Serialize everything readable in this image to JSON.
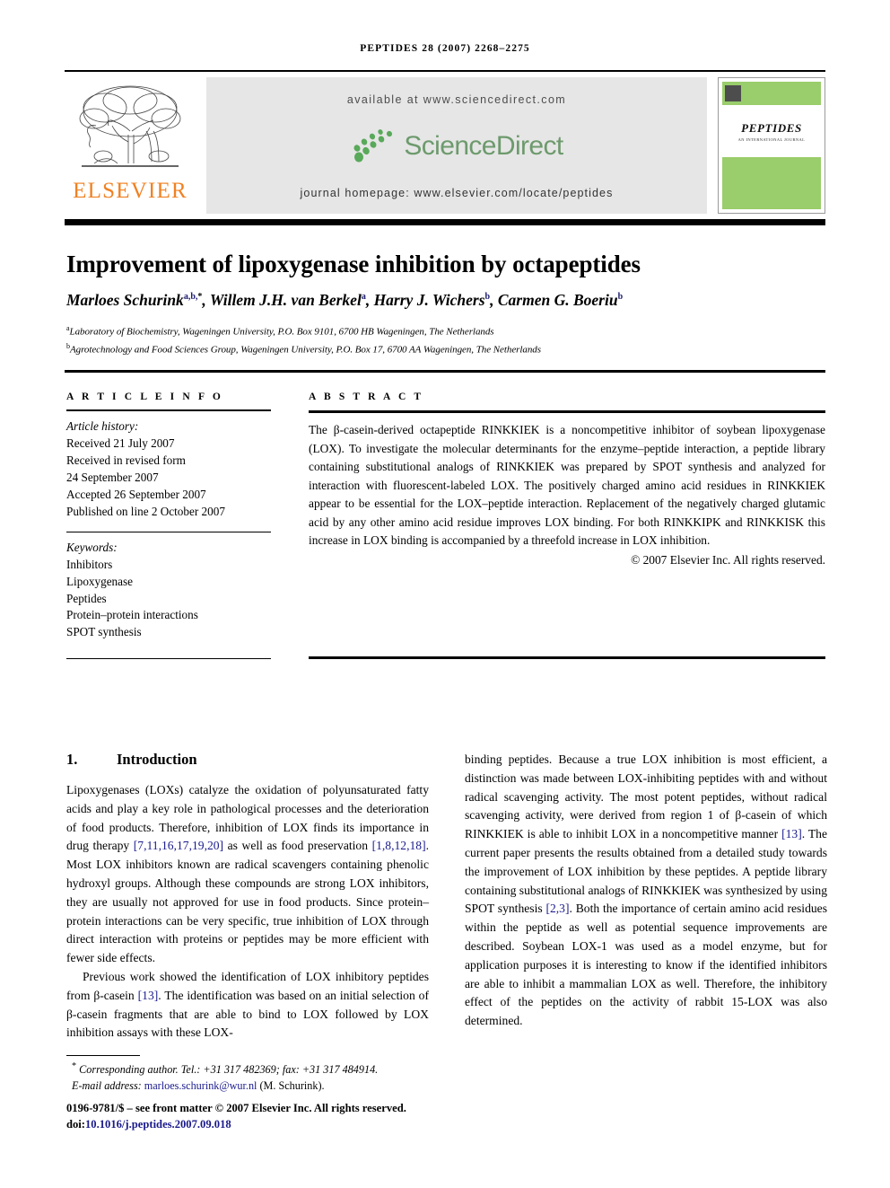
{
  "running_head": "PEPTIDES 28 (2007) 2268–2275",
  "masthead": {
    "publisher_name": "ELSEVIER",
    "available_at": "available at www.sciencedirect.com",
    "sciencedirect_wordmark": "ScienceDirect",
    "journal_homepage": "journal homepage: www.elsevier.com/locate/peptides",
    "cover": {
      "title": "PEPTIDES",
      "subtitle": "AN INTERNATIONAL JOURNAL",
      "accent_color": "#9ACD6B"
    },
    "elsevier_color": "#F08122",
    "sciencedirect_green": "#6d9a6d",
    "banner_bg": "#e6e6e6"
  },
  "article": {
    "title": "Improvement of lipoxygenase inhibition by octapeptides",
    "authors_html": "Marloes Schurink<sup>a,b,*</sup>, Willem J.H. van Berkel<sup>a</sup>, Harry J. Wichers<sup>b</sup>, Carmen G. Boeriu<sup>b</sup>",
    "affiliation_a": "Laboratory of Biochemistry, Wageningen University, P.O. Box 9101, 6700 HB Wageningen, The Netherlands",
    "affiliation_b": "Agrotechnology and Food Sciences Group, Wageningen University, P.O. Box 17, 6700 AA Wageningen, The Netherlands",
    "affiliation_a_marker": "a",
    "affiliation_b_marker": "b"
  },
  "article_info": {
    "heading": "A R T I C L E   I N F O",
    "history_label": "Article history:",
    "history": [
      "Received 21 July 2007",
      "Received in revised form",
      "24 September 2007",
      "Accepted 26 September 2007",
      "Published on line 2 October 2007"
    ],
    "keywords_label": "Keywords:",
    "keywords": [
      "Inhibitors",
      "Lipoxygenase",
      "Peptides",
      "Protein–protein interactions",
      "SPOT synthesis"
    ]
  },
  "abstract": {
    "heading": "A B S T R A C T",
    "text": "The β-casein-derived octapeptide RINKKIEK is a noncompetitive inhibitor of soybean lipoxygenase (LOX). To investigate the molecular determinants for the enzyme–peptide interaction, a peptide library containing substitutional analogs of RINKKIEK was prepared by SPOT synthesis and analyzed for interaction with fluorescent-labeled LOX. The positively charged amino acid residues in RINKKIEK appear to be essential for the LOX–peptide interaction. Replacement of the negatively charged glutamic acid by any other amino acid residue improves LOX binding. For both RINKKIPK and RINKKISK this increase in LOX binding is accompanied by a threefold increase in LOX inhibition.",
    "copyright": "© 2007 Elsevier Inc. All rights reserved."
  },
  "introduction": {
    "number": "1.",
    "heading": "Introduction",
    "left_paragraph_1_parts": [
      "Lipoxygenases (LOXs) catalyze the oxidation of polyunsaturated fatty acids and play a key role in pathological processes and the deterioration of food products. Therefore, inhibition of LOX finds its importance in drug therapy ",
      "[7,11,16,17,19,20]",
      " as well as food preservation ",
      "[1,8,12,18]",
      ". Most LOX inhibitors known are radical scavengers containing phenolic hydroxyl groups. Although these compounds are strong LOX inhibitors, they are usually not approved for use in food products. Since protein–protein interactions can be very specific, true inhibition of LOX through direct interaction with proteins or peptides may be more efficient with fewer side effects."
    ],
    "left_paragraph_2_parts": [
      "Previous work showed the identification of LOX inhibitory peptides from β-casein ",
      "[13]",
      ". The identification was based on an initial selection of β-casein fragments that are able to bind to LOX followed by LOX inhibition assays with these LOX-"
    ],
    "right_paragraph_parts": [
      "binding peptides. Because a true LOX inhibition is most efficient, a distinction was made between LOX-inhibiting peptides with and without radical scavenging activity. The most potent peptides, without radical scavenging activity, were derived from region 1 of β-casein of which RINKKIEK is able to inhibit LOX in a noncompetitive manner ",
      "[13]",
      ". The current paper presents the results obtained from a detailed study towards the improvement of LOX inhibition by these peptides. A peptide library containing substitutional analogs of RINKKIEK was synthesized by using SPOT synthesis ",
      "[2,3]",
      ". Both the importance of certain amino acid residues within the peptide as well as potential sequence improvements are described. Soybean LOX-1 was used as a model enzyme, but for application purposes it is interesting to know if the identified inhibitors are able to inhibit a mammalian LOX as well. Therefore, the inhibitory effect of the peptides on the activity of rabbit 15-LOX was also determined."
    ]
  },
  "footnotes": {
    "corresponding_marker": "*",
    "corresponding_text": "Corresponding author. Tel.: +31 317 482369; fax: +31 317 484914.",
    "email_label": "E-mail address:",
    "email": "marloes.schurink@wur.nl",
    "email_owner": "(M. Schurink).",
    "issn_line": "0196-9781/$ – see front matter © 2007 Elsevier Inc. All rights reserved.",
    "doi_label": "doi:",
    "doi": "10.1016/j.peptides.2007.09.018"
  },
  "colors": {
    "link": "#1a1a8c",
    "reference": "#1a1a8c"
  }
}
